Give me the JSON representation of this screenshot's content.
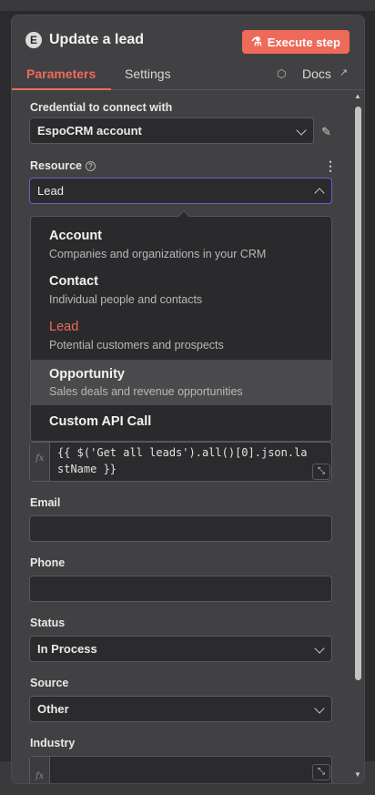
{
  "header": {
    "icon_letter": "E",
    "title": "Update a lead",
    "execute_button": {
      "label": "Execute step",
      "icon": "flask-icon"
    }
  },
  "tabs": {
    "parameters": "Parameters",
    "settings": "Settings",
    "docs": "Docs"
  },
  "credential": {
    "label": "Credential to connect with",
    "value": "EspoCRM account"
  },
  "resource": {
    "label": "Resource",
    "value": "Lead",
    "options": [
      {
        "title": "Account",
        "description": "Companies and organizations in your CRM"
      },
      {
        "title": "Contact",
        "description": "Individual people and contacts"
      },
      {
        "title": "Lead",
        "description": "Potential customers and prospects"
      },
      {
        "title": "Opportunity",
        "description": "Sales deals and revenue opportunities"
      },
      {
        "title": "Custom API Call",
        "description": ""
      }
    ]
  },
  "last_name_expression": "{{ $('Get all leads').all()[0].json.lastName }}",
  "email": {
    "label": "Email",
    "value": ""
  },
  "phone": {
    "label": "Phone",
    "value": ""
  },
  "status": {
    "label": "Status",
    "value": "In Process"
  },
  "source": {
    "label": "Source",
    "value": "Other"
  },
  "industry": {
    "label": "Industry",
    "value": ""
  },
  "colors": {
    "accent": "#ee6a5a",
    "panel": "#414143",
    "field": "#2b2b2d"
  }
}
